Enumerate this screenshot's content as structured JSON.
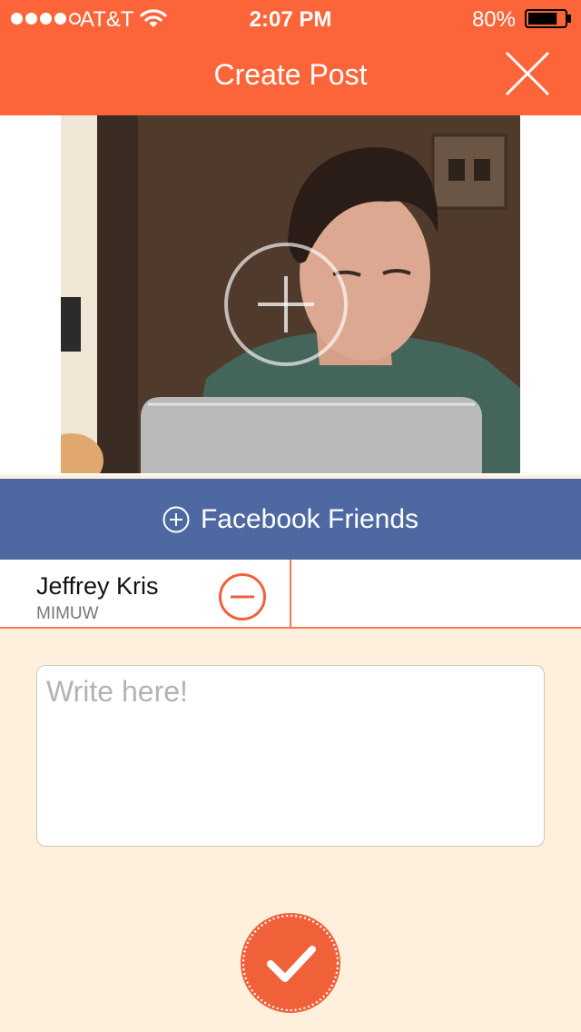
{
  "status_bar": {
    "carrier": "AT&T",
    "time": "2:07 PM",
    "battery_percent": "80%",
    "signal_bars_filled": 4,
    "signal_bars_total": 5,
    "battery_level": 0.8
  },
  "header": {
    "title": "Create Post",
    "close_icon": "close-x-icon"
  },
  "photo": {
    "add_icon": "plus-circle-icon"
  },
  "facebook": {
    "label": "Facebook Friends",
    "icon": "plus-circle-icon",
    "color": "#4e69a2"
  },
  "friends": [
    {
      "name": "Jeffrey Kris",
      "org": "MIMUW",
      "remove_icon": "minus-circle-icon"
    }
  ],
  "post": {
    "placeholder": "Write here!"
  },
  "submit": {
    "icon": "checkmark-icon"
  },
  "colors": {
    "accent": "#fb6539",
    "background": "#fef0dc",
    "facebook": "#4e69a2"
  }
}
